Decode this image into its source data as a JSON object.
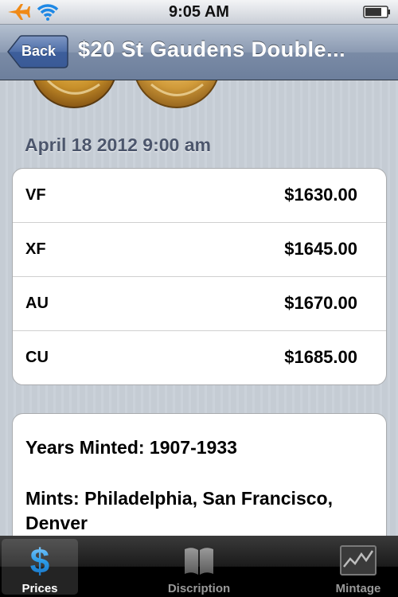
{
  "status_bar": {
    "time": "9:05 AM",
    "icons": [
      "airplane-icon",
      "wifi-icon",
      "battery-icon"
    ]
  },
  "nav": {
    "back_label": "Back",
    "title": "$20 St Gaudens Double..."
  },
  "prices": {
    "date": "April 18 2012 9:00 am",
    "rows": [
      {
        "grade": "VF",
        "price": "$1630.00"
      },
      {
        "grade": "XF",
        "price": "$1645.00"
      },
      {
        "grade": "AU",
        "price": "$1670.00"
      },
      {
        "grade": "CU",
        "price": "$1685.00"
      }
    ]
  },
  "info": {
    "years_minted": "Years Minted: 1907-1933",
    "mints_line1": "Mints: Philadelphia, San Francisco,",
    "mints_line2": "Denver"
  },
  "tabs": [
    {
      "label": "Prices",
      "icon": "dollar-sign-icon",
      "selected": true
    },
    {
      "label": "Discription",
      "icon": "book-icon",
      "selected": false
    },
    {
      "label": "Mintage",
      "icon": "chart-icon",
      "selected": false
    }
  ],
  "colors": {
    "nav_bar": "#7a8ba6",
    "background": "#c5ccd4",
    "date_text": "#4c566c",
    "tab_selected_icon": "#2a9be8"
  }
}
